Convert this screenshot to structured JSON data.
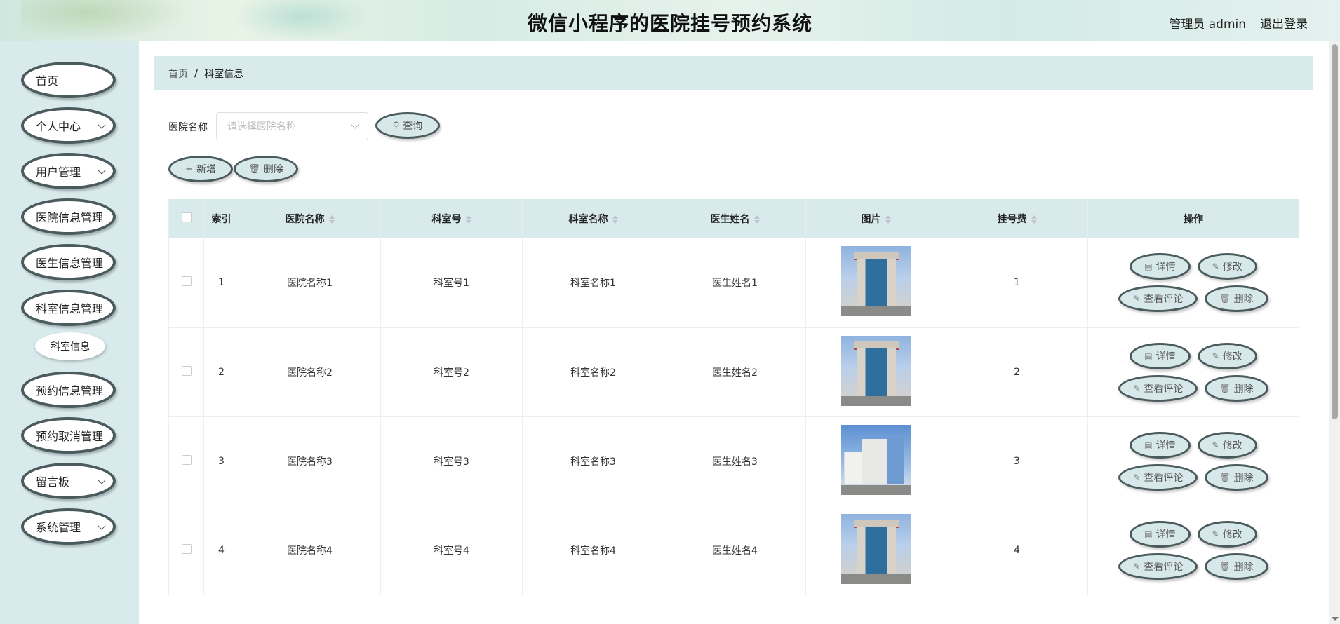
{
  "header": {
    "title": "微信小程序的医院挂号预约系统",
    "admin_label": "管理员 admin",
    "logout_label": "退出登录"
  },
  "sidebar": {
    "items": [
      {
        "label": "首页",
        "has_children": false
      },
      {
        "label": "个人中心",
        "has_children": true
      },
      {
        "label": "用户管理",
        "has_children": true
      },
      {
        "label": "医院信息管理",
        "has_children": false
      },
      {
        "label": "医生信息管理",
        "has_children": false
      },
      {
        "label": "科室信息管理",
        "has_children": false
      },
      {
        "label": "预约信息管理",
        "has_children": false
      },
      {
        "label": "预约取消管理",
        "has_children": false
      },
      {
        "label": "留言板",
        "has_children": true
      },
      {
        "label": "系统管理",
        "has_children": true
      }
    ],
    "submenu_label": "科室信息"
  },
  "breadcrumb": {
    "home": "首页",
    "separator": "/",
    "current": "科室信息"
  },
  "search": {
    "label": "医院名称",
    "placeholder": "请选择医院名称",
    "query_button": "查询"
  },
  "toolbar": {
    "add_button": "新增",
    "delete_button": "删除"
  },
  "table": {
    "headers": [
      "索引",
      "医院名称",
      "科室号",
      "科室名称",
      "医生姓名",
      "图片",
      "挂号费",
      "操作"
    ],
    "rows": [
      {
        "index": "1",
        "hospital": "医院名称1",
        "dept_no": "科室号1",
        "dept_name": "科室名称1",
        "doctor": "医生姓名1",
        "fee": "1"
      },
      {
        "index": "2",
        "hospital": "医院名称2",
        "dept_no": "科室号2",
        "dept_name": "科室名称2",
        "doctor": "医生姓名2",
        "fee": "2"
      },
      {
        "index": "3",
        "hospital": "医院名称3",
        "dept_no": "科室号3",
        "dept_name": "科室名称3",
        "doctor": "医生姓名3",
        "fee": "3"
      },
      {
        "index": "4",
        "hospital": "医院名称4",
        "dept_no": "科室号4",
        "dept_name": "科室名称4",
        "doctor": "医生姓名4",
        "fee": "4"
      }
    ],
    "actions": {
      "detail": "详情",
      "edit": "修改",
      "comments": "查看评论",
      "delete": "删除"
    }
  }
}
